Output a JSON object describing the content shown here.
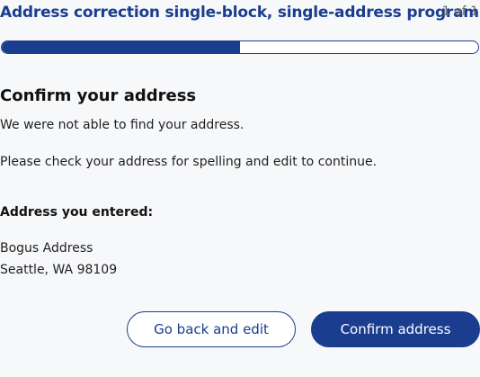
{
  "header": {
    "program_title": "Address correction single-block, single-address program",
    "page_count": "1 of 1"
  },
  "progress": {
    "fraction": 0.5,
    "color": "#1a3d8f"
  },
  "content": {
    "title": "Confirm your address",
    "message_1": "We were not able to find your address.",
    "message_2": "Please check your address for spelling and edit to continue.",
    "entered_label": "Address you entered:",
    "address_line_1": "Bogus Address",
    "address_line_2": "Seattle, WA 98109"
  },
  "actions": {
    "back_label": "Go back and edit",
    "confirm_label": "Confirm address"
  },
  "colors": {
    "brand": "#1a3d8f",
    "background": "#f7f8fa"
  }
}
